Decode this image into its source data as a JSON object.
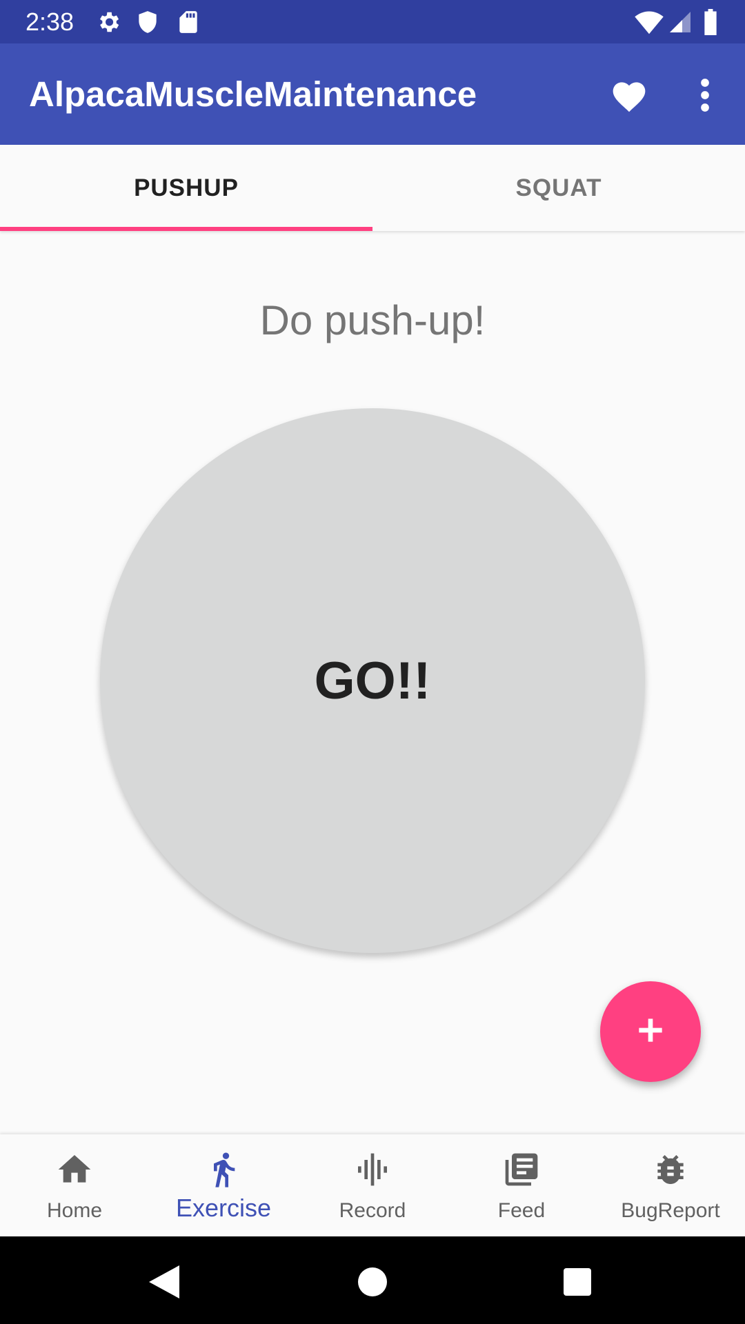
{
  "status_bar": {
    "time": "2:38",
    "icons": [
      "settings-icon",
      "shield-icon",
      "sd-card-icon",
      "wifi-icon",
      "signal-icon",
      "battery-icon"
    ]
  },
  "app_bar": {
    "title": "AlpacaMuscleMaintenance",
    "actions": [
      "heart-icon",
      "more-vert-icon"
    ]
  },
  "tabs": [
    {
      "label": "PUSHUP",
      "selected": true
    },
    {
      "label": "SQUAT",
      "selected": false
    }
  ],
  "main": {
    "prompt": "Do push-up!",
    "go_button_label": "GO!!"
  },
  "fab": {
    "icon": "plus-icon"
  },
  "bottom_nav": [
    {
      "label": "Home",
      "icon": "home-icon",
      "selected": false
    },
    {
      "label": "Exercise",
      "icon": "run-icon",
      "selected": true
    },
    {
      "label": "Record",
      "icon": "audio-wave-icon",
      "selected": false
    },
    {
      "label": "Feed",
      "icon": "feed-icon",
      "selected": false
    },
    {
      "label": "BugReport",
      "icon": "bug-icon",
      "selected": false
    }
  ],
  "colors": {
    "primary_dark": "#303f9f",
    "primary": "#3f51b5",
    "accent": "#ff4081",
    "circle": "#d7d8d8"
  }
}
